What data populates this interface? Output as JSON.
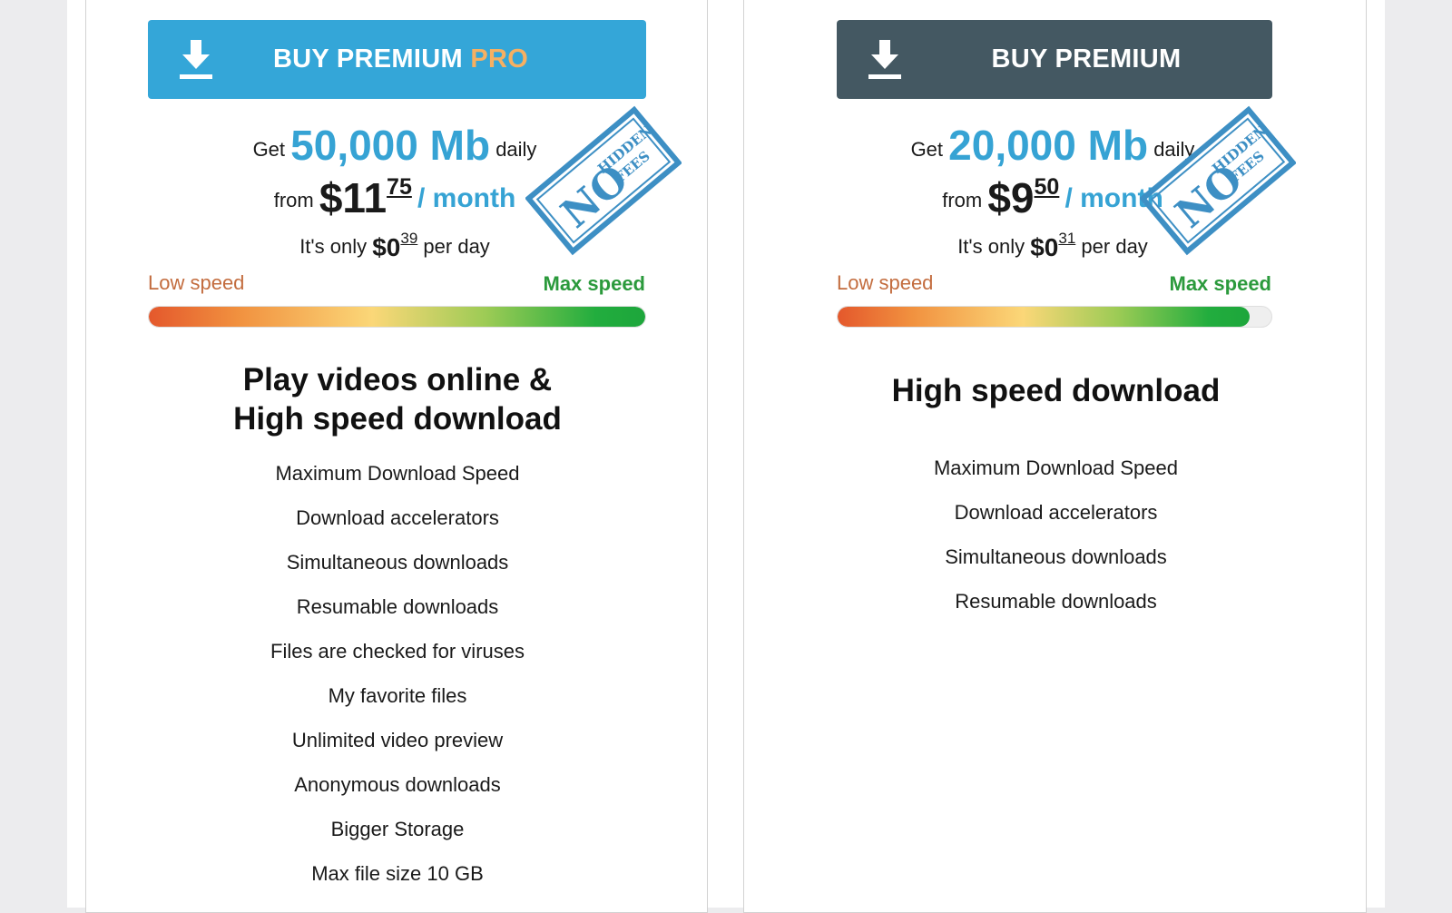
{
  "colors": {
    "accent_blue": "#34a6d8",
    "dark_slate": "#445862",
    "pro_orange": "#f6b062",
    "low_speed": "#c36c3e",
    "max_speed": "#2b9a3c",
    "stamp_blue": "#3d8fc4"
  },
  "plans": [
    {
      "button": {
        "icon": "download-icon",
        "label_main": "BUY PREMIUM",
        "label_pro": "PRO"
      },
      "offer": {
        "get_prefix": "Get",
        "amount": "50,000 Mb",
        "get_suffix": "daily",
        "from_prefix": "from",
        "price_dollars": "$11",
        "price_cents": "75",
        "per_month": "/ month",
        "day_prefix": "It's only",
        "day_dollars": "$0",
        "day_cents": "39",
        "day_suffix": "per day"
      },
      "stamp": {
        "line1": "NO",
        "line2": "HIDDEN",
        "line3": "FEES"
      },
      "speed": {
        "low_label": "Low speed",
        "max_label": "Max speed",
        "level": 1.0
      },
      "title_line1": "Play videos online &",
      "title_line2": "High speed download",
      "features": [
        "Maximum Download Speed",
        "Download accelerators",
        "Simultaneous downloads",
        "Resumable downloads",
        "Files are checked for viruses",
        "My favorite files",
        "Unlimited video preview",
        "Anonymous downloads",
        "Bigger Storage",
        "Max file size 10 GB"
      ]
    },
    {
      "button": {
        "icon": "download-icon",
        "label_main": "BUY PREMIUM"
      },
      "offer": {
        "get_prefix": "Get",
        "amount": "20,000 Mb",
        "get_suffix": "daily",
        "from_prefix": "from",
        "price_dollars": "$9",
        "price_cents": "50",
        "per_month": "/ month",
        "day_prefix": "It's only",
        "day_dollars": "$0",
        "day_cents": "31",
        "day_suffix": "per day"
      },
      "stamp": {
        "line1": "NO",
        "line2": "HIDDEN",
        "line3": "FEES"
      },
      "speed": {
        "low_label": "Low speed",
        "max_label": "Max speed",
        "level": 0.95
      },
      "title": "High speed download",
      "features": [
        "Maximum Download Speed",
        "Download accelerators",
        "Simultaneous downloads",
        "Resumable downloads"
      ]
    }
  ]
}
